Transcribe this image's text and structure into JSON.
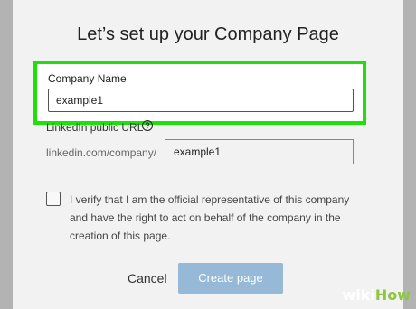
{
  "dialog": {
    "title": "Let’s set up your Company Page",
    "company_name_label": "Company Name",
    "company_name_value": "example1",
    "url_label": "LinkedIn public URL",
    "url_help_icon": "question-circle-icon",
    "url_prefix": "linkedin.com/company/",
    "url_value": "example1",
    "verify_checked": false,
    "verify_text": "I verify that I am the official representative of this company and have the right to act on behalf of the company in the creation of this page.",
    "cancel_label": "Cancel",
    "create_label": "Create page"
  },
  "watermark": {
    "part1": "wiki",
    "part2": "How"
  },
  "colors": {
    "highlight": "#1fe00a",
    "create_button": "#95b9d6",
    "backdrop": "#b3b3b3",
    "dialog_bg": "#f2f2f2"
  }
}
